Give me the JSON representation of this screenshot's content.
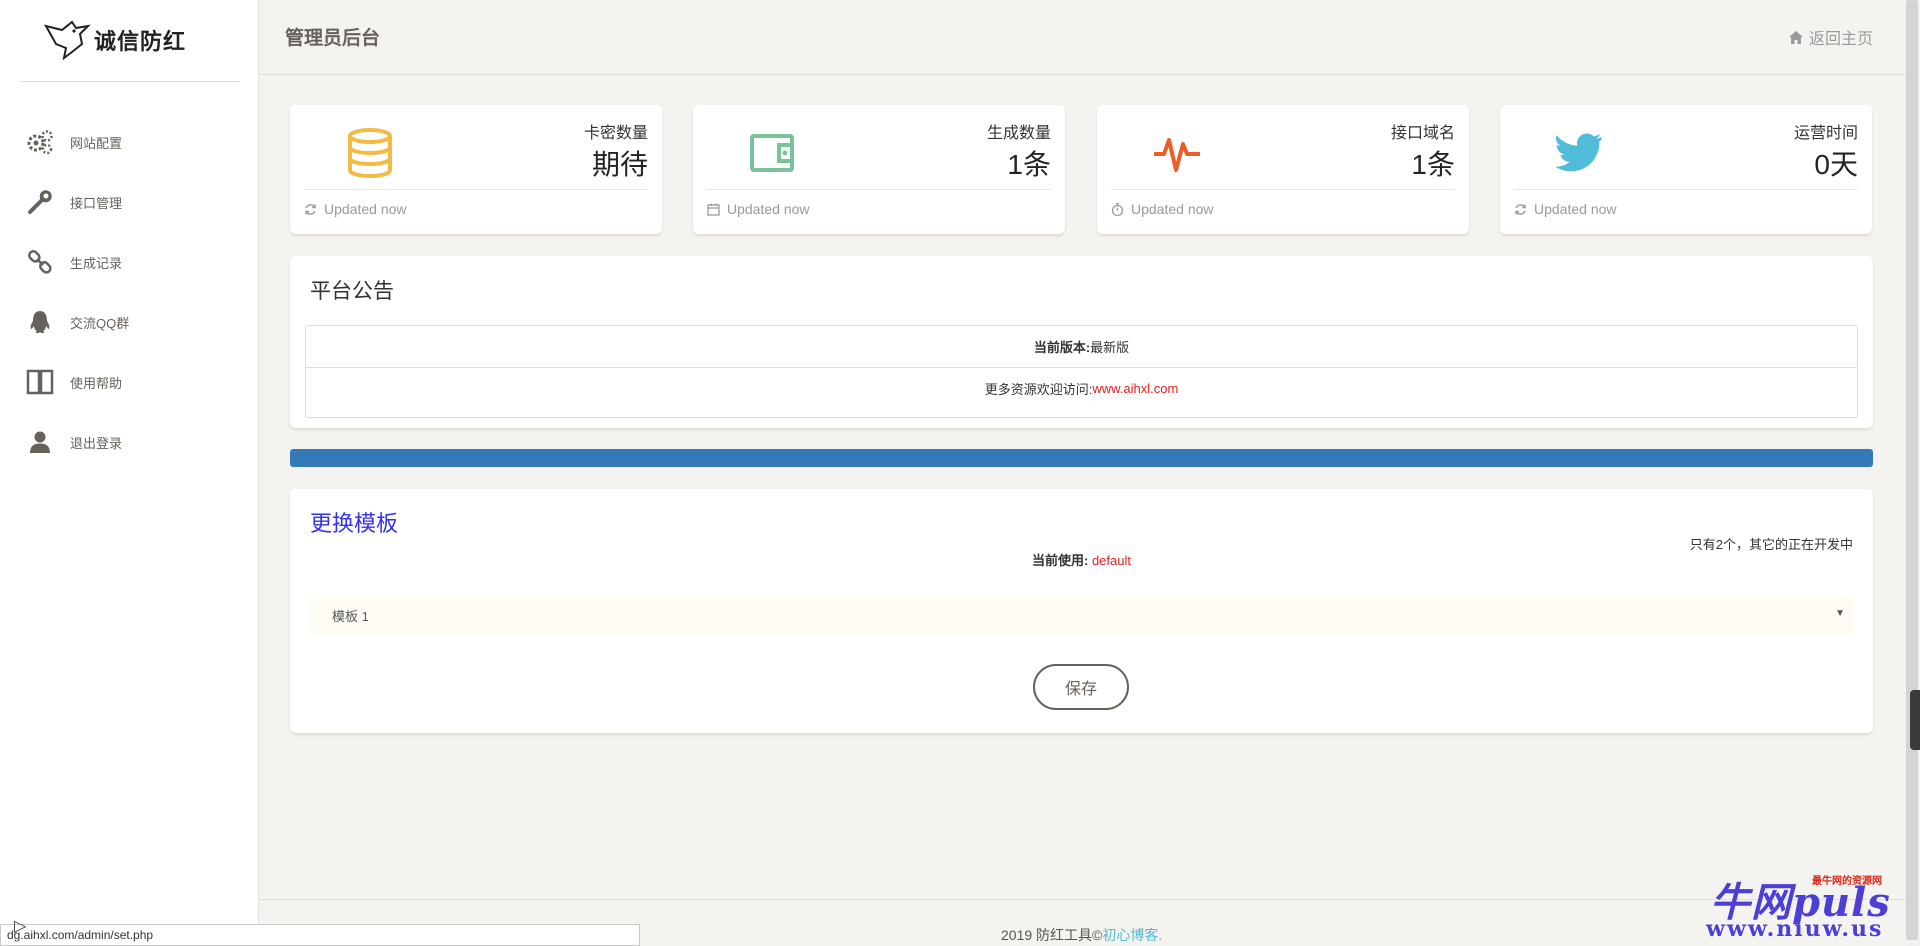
{
  "brand": {
    "logo_text": "诚信防红"
  },
  "sidebar": {
    "items": [
      {
        "label": "网站配置",
        "icon": "gears-icon"
      },
      {
        "label": "接口管理",
        "icon": "wrench-icon"
      },
      {
        "label": "生成记录",
        "icon": "link-icon"
      },
      {
        "label": "交流QQ群",
        "icon": "qq-icon"
      },
      {
        "label": "使用帮助",
        "icon": "book-icon"
      },
      {
        "label": "退出登录",
        "icon": "user-icon"
      }
    ]
  },
  "header": {
    "title": "管理员后台",
    "home_link": "返回主页"
  },
  "stats": [
    {
      "label": "卡密数量",
      "value": "期待",
      "footer": "Updated now",
      "icon": "database-icon",
      "color": "#f3bb45"
    },
    {
      "label": "生成数量",
      "value": "1条",
      "footer": "Updated now",
      "icon": "wallet-icon",
      "color": "#7ac29a"
    },
    {
      "label": "接口域名",
      "value": "1条",
      "footer": "Updated now",
      "icon": "pulse-icon",
      "color": "#eb5e28"
    },
    {
      "label": "运营时间",
      "value": "0天",
      "footer": "Updated now",
      "icon": "twitter-icon",
      "color": "#51bcda"
    }
  ],
  "announcement": {
    "title": "平台公告",
    "version_label": "当前版本:",
    "version_value": "最新版",
    "visit_label": "更多资源欢迎访问:",
    "visit_link": "www.aihxl.com"
  },
  "progress": {
    "value": 1.0,
    "color": "#337ab7"
  },
  "template": {
    "title": "更换模板",
    "note": "只有2个，其它的正在开发中",
    "current_label": "当前使用:",
    "current_value": "default",
    "selected": "模板 1",
    "save_label": "保存"
  },
  "footer": {
    "text": "2019 防红工具©",
    "link": "初心博客."
  },
  "statusbar": {
    "url": "dg.aihxl.com/admin/set.php"
  },
  "watermark": {
    "main": "牛网puls",
    "sub": "www.niuw.us",
    "tag": "最牛网的资源网"
  }
}
